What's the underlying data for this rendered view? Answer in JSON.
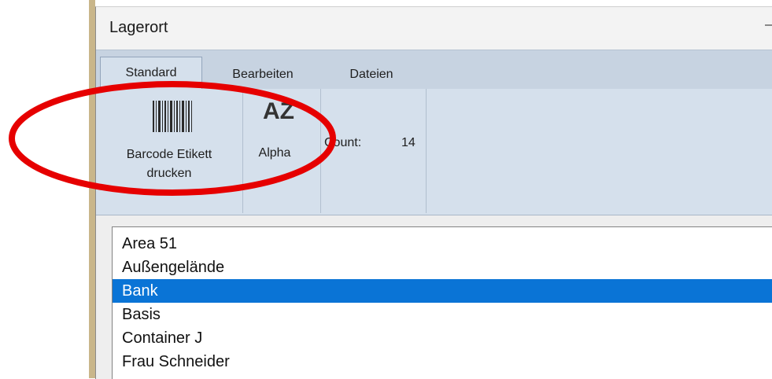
{
  "window": {
    "title": "Lagerort"
  },
  "ribbon": {
    "tabs": [
      {
        "label": "Standard",
        "active": true
      },
      {
        "label": "Bearbeiten",
        "active": false
      },
      {
        "label": "Dateien",
        "active": false
      }
    ],
    "buttons": {
      "barcode_line1": "Barcode Etikett",
      "barcode_line2": "drucken",
      "alpha_icon": "AZ",
      "alpha_label": "Alpha"
    },
    "count": {
      "label": "Count:",
      "value": "14"
    }
  },
  "list": {
    "items": [
      "Area 51",
      "Außengelände",
      "Bank",
      "Basis",
      "Container J",
      "Frau Schneider"
    ],
    "selected": "Bank"
  },
  "colors": {
    "selection": "#0a74d6",
    "ribbon": "#d5e0ec",
    "annotation": "#e60000"
  },
  "icons": [
    "barcode-icon",
    "sort-alpha-icon"
  ]
}
